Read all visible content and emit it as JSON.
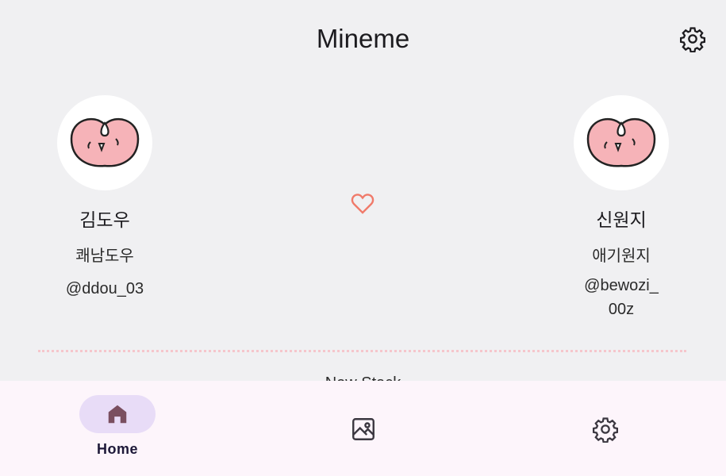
{
  "app": {
    "title": "Mineme"
  },
  "profiles": {
    "left": {
      "name": "김도우",
      "nickname": "쾌남도우",
      "handle": "@ddou_03"
    },
    "right": {
      "name": "신원지",
      "nickname": "애기원지",
      "handle": "@bewozi_00z"
    }
  },
  "peek_text": "New Stack",
  "bottom_nav": {
    "home_label": "Home",
    "active": "home"
  },
  "colors": {
    "background": "#f0f0f2",
    "heart": "#f07a6a",
    "avatar_fill": "#f6b3b8",
    "nav_background": "#fdf5fb",
    "nav_active_pill": "#e8dcf7",
    "home_icon": "#7a4f60",
    "divider": "#f6c6cc"
  },
  "icons": {
    "top_right": "settings-gear-icon",
    "center": "heart-outline-icon",
    "nav": [
      "home-icon",
      "image-gallery-icon",
      "settings-gear-icon"
    ]
  }
}
